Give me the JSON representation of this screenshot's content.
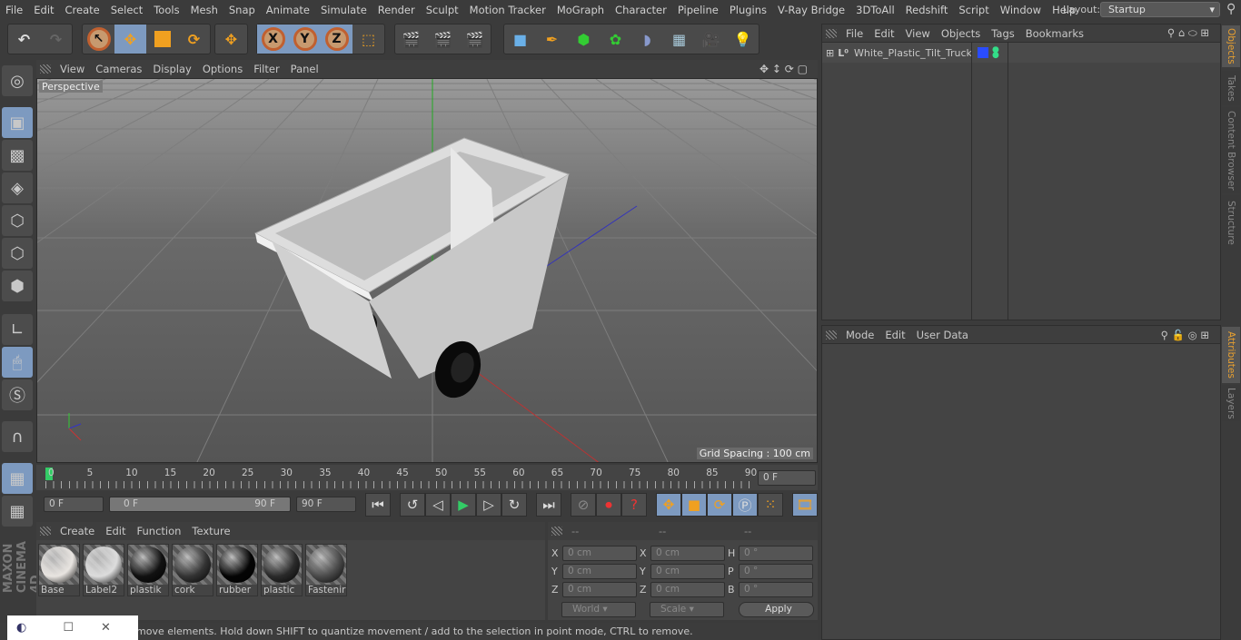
{
  "menu": [
    "File",
    "Edit",
    "Create",
    "Select",
    "Tools",
    "Mesh",
    "Snap",
    "Animate",
    "Simulate",
    "Render",
    "Sculpt",
    "Motion Tracker",
    "MoGraph",
    "Character",
    "Pipeline",
    "Plugins",
    "V-Ray Bridge",
    "3DToAll",
    "Redshift",
    "Script",
    "Window",
    "Help"
  ],
  "layout": {
    "label": "Layout:",
    "value": "Startup"
  },
  "viewport": {
    "menu": [
      "View",
      "Cameras",
      "Display",
      "Options",
      "Filter",
      "Panel"
    ],
    "camera": "Perspective",
    "grid_spacing": "Grid Spacing : 100 cm"
  },
  "timeline": {
    "ticks": [
      "0",
      "5",
      "10",
      "15",
      "20",
      "25",
      "30",
      "35",
      "40",
      "45",
      "50",
      "55",
      "60",
      "65",
      "70",
      "75",
      "80",
      "85",
      "90"
    ],
    "current": "0 F",
    "start": "0 F",
    "range_start": "0 F",
    "range_end": "90 F",
    "end": "90 F"
  },
  "materials": {
    "menu": [
      "Create",
      "Edit",
      "Function",
      "Texture"
    ],
    "items": [
      {
        "name": "Base",
        "color": "#e8e4e0"
      },
      {
        "name": "Label2",
        "color": "#dcdcdc"
      },
      {
        "name": "plastik",
        "color": "#111111"
      },
      {
        "name": "cork",
        "color": "#333333"
      },
      {
        "name": "rubber",
        "color": "#050505"
      },
      {
        "name": "plastic",
        "color": "#2a2a2a"
      },
      {
        "name": "Fastenir",
        "color": "#4a4a4a"
      }
    ]
  },
  "coords": {
    "headers": [
      "--",
      "--",
      "--"
    ],
    "rows": [
      {
        "a": "X",
        "av": "0 cm",
        "b": "X",
        "bv": "0 cm",
        "c": "H",
        "cv": "0 °"
      },
      {
        "a": "Y",
        "av": "0 cm",
        "b": "Y",
        "bv": "0 cm",
        "c": "P",
        "cv": "0 °"
      },
      {
        "a": "Z",
        "av": "0 cm",
        "b": "Z",
        "bv": "0 cm",
        "c": "B",
        "cv": "0 °"
      }
    ],
    "world": "World",
    "scale": "Scale",
    "apply": "Apply"
  },
  "status": "move elements. Hold down SHIFT to quantize movement / add to the selection in point mode, CTRL to remove.",
  "objects": {
    "menu": [
      "File",
      "Edit",
      "View",
      "Objects",
      "Tags",
      "Bookmarks"
    ],
    "items": [
      {
        "name": "White_Plastic_Tilt_Truck",
        "tag_color": "#2a4cff"
      }
    ]
  },
  "attributes": {
    "menu": [
      "Mode",
      "Edit",
      "User Data"
    ]
  },
  "side_tabs_top": [
    "Objects",
    "Takes",
    "Content Browser",
    "Structure"
  ],
  "side_tabs_bottom": [
    "Attributes",
    "Layers"
  ],
  "brand": "MAXON CINEMA 4D"
}
